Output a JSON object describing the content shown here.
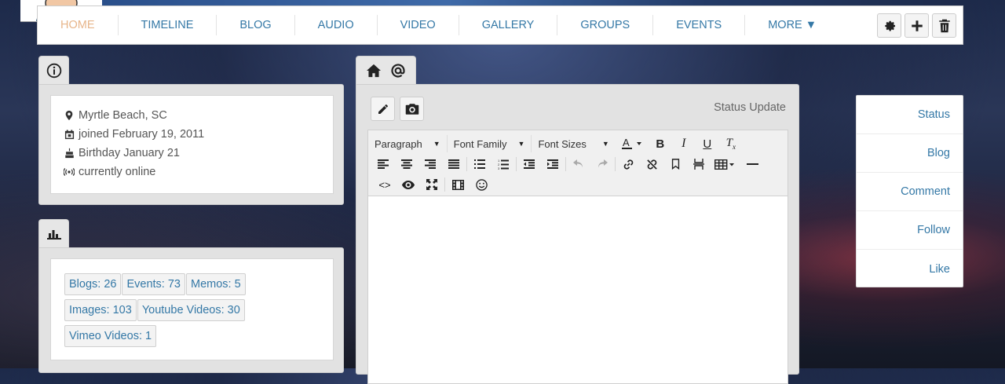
{
  "nav": {
    "items": [
      {
        "label": "HOME",
        "active": true
      },
      {
        "label": "TIMELINE"
      },
      {
        "label": "BLOG"
      },
      {
        "label": "AUDIO"
      },
      {
        "label": "VIDEO"
      },
      {
        "label": "GALLERY"
      },
      {
        "label": "GROUPS"
      },
      {
        "label": "EVENTS"
      },
      {
        "label": "MORE ▼"
      }
    ],
    "actions": [
      "gear-icon",
      "plus-icon",
      "trash-icon"
    ]
  },
  "info": {
    "location": "Myrtle Beach, SC",
    "joined": "joined February 19, 2011",
    "birthday": "Birthday January 21",
    "online": "currently online"
  },
  "stats": [
    "Blogs: 26",
    "Events: 73",
    "Memos: 5",
    "Images: 103",
    "Youtube Videos: 30",
    "Vimeo Videos: 1"
  ],
  "editor": {
    "status_label": "Status Update",
    "paragraph": "Paragraph",
    "font_family": "Font Family",
    "font_sizes": "Font Sizes"
  },
  "side_menu": [
    "Status",
    "Blog",
    "Comment",
    "Follow",
    "Like"
  ],
  "colors": {
    "link": "#3478a6",
    "active_nav": "#e7b58a"
  }
}
